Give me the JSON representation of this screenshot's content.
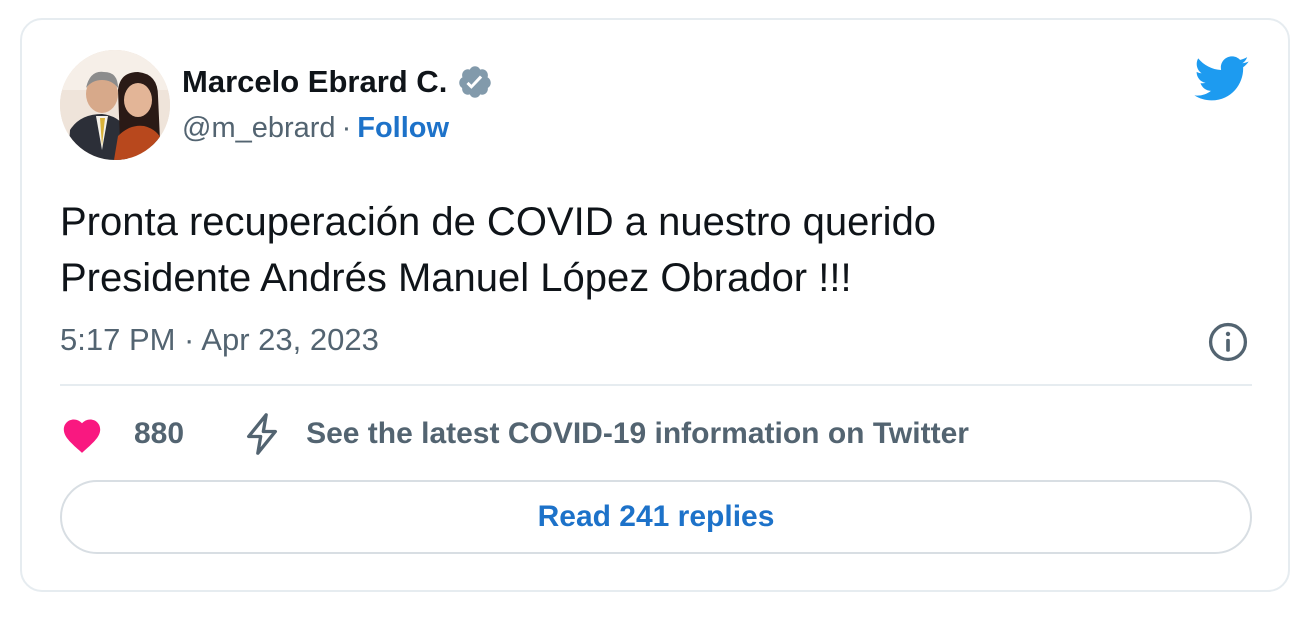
{
  "author": {
    "name": "Marcelo Ebrard C.",
    "handle": "@m_ebrard",
    "separator": "·",
    "follow_label": "Follow",
    "avatar_icon": "profile-photo",
    "verified_icon": "verified-badge-icon"
  },
  "tweet": {
    "lines": [
      "Pronta recuperación de COVID a nuestro querido",
      "Presidente Andrés Manuel López Obrador !!!"
    ],
    "timestamp": "5:17 PM · Apr 23, 2023"
  },
  "actions": {
    "like_count": "880",
    "covid_link": "See the latest COVID-19 information on Twitter",
    "read_replies": "Read 241 replies"
  },
  "colors": {
    "twitter_blue": "#1d9bf0",
    "link_blue": "#1d72c9",
    "heart_pink": "#f91880",
    "muted_text": "#536471",
    "verified_grey": "#829aab"
  }
}
